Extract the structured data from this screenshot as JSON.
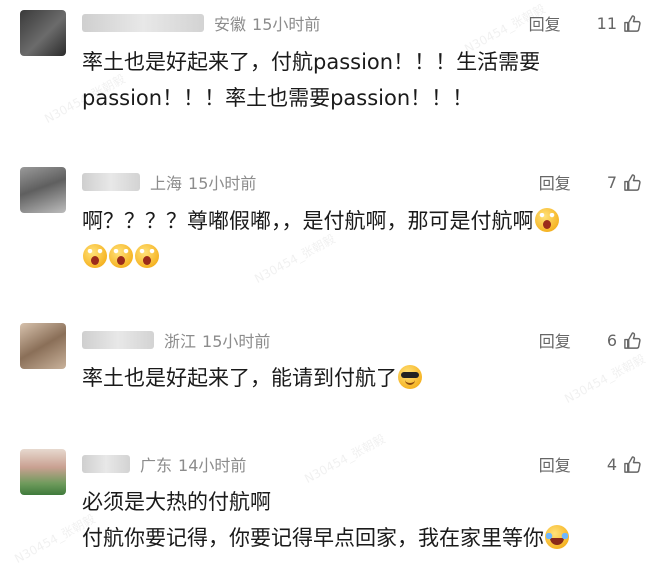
{
  "reply_label": "回复",
  "comments": [
    {
      "region": "安徽",
      "time": "15小时前",
      "likes": "11",
      "lines": [
        "率土也是好起来了，付航passion！！！生活需要",
        "passion！！！率土也需要passion！！！"
      ]
    },
    {
      "region": "上海",
      "time": "15小时前",
      "likes": "7",
      "lines": [
        "啊？？？？尊嘟假嘟，，是付航啊，那可是付航啊",
        ""
      ],
      "emojis_line1": [
        "face-with-open-mouth-emoji"
      ],
      "emojis_line2": [
        "face-with-open-mouth-emoji",
        "face-with-open-mouth-emoji",
        "face-with-open-mouth-emoji"
      ]
    },
    {
      "region": "浙江",
      "time": "15小时前",
      "likes": "6",
      "lines": [
        "率土也是好起来了，能请到付航了"
      ],
      "emojis_line1": [
        "sunglasses-face-emoji"
      ]
    },
    {
      "region": "广东",
      "time": "14小时前",
      "likes": "4",
      "lines": [
        "必须是大热的付航啊",
        "付航你要记得，你要记得早点回家，我在家里等你"
      ],
      "emojis_line2": [
        "laughing-tears-face-emoji"
      ]
    }
  ],
  "watermark_text": "N30454_张朝毅",
  "colors": {
    "meta_gray": "#8c8c8c",
    "text": "#1a1a1a",
    "icon_gray": "#666666"
  }
}
